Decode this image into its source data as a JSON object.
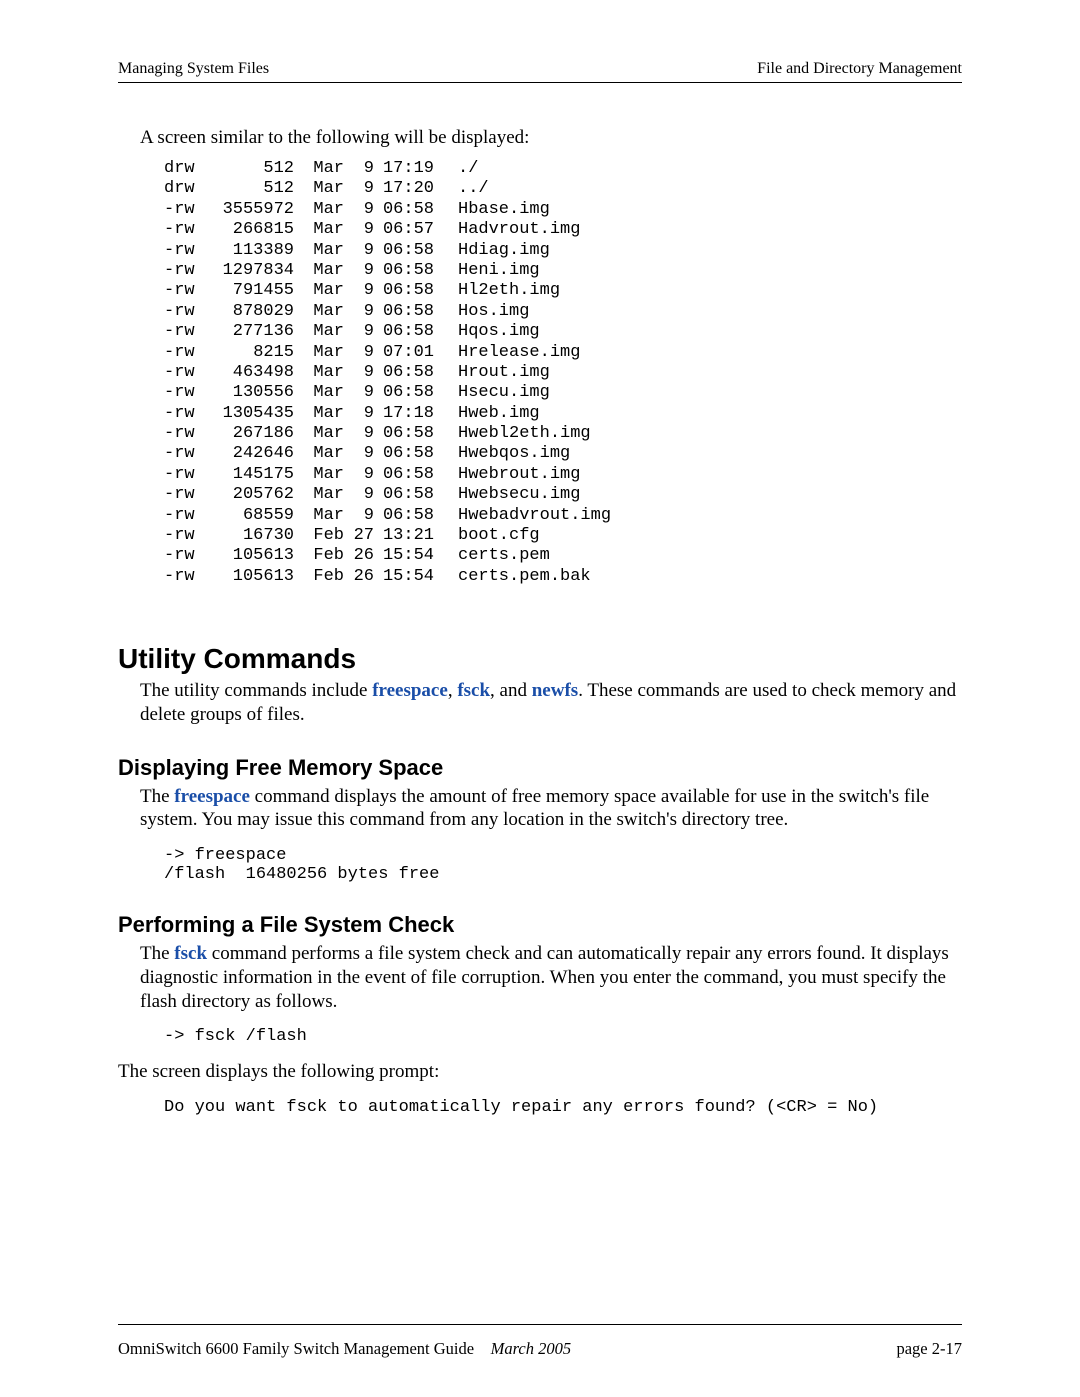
{
  "header": {
    "left": "Managing System Files",
    "right": "File and Directory Management"
  },
  "intro": "A screen similar to the following will be displayed:",
  "listing": [
    {
      "perm": "drw",
      "size": "512",
      "mon": "Mar",
      "day": "9",
      "time": "17:19",
      "name": "./"
    },
    {
      "perm": "drw",
      "size": "512",
      "mon": "Mar",
      "day": "9",
      "time": "17:20",
      "name": "../"
    },
    {
      "perm": "-rw",
      "size": "3555972",
      "mon": "Mar",
      "day": "9",
      "time": "06:58",
      "name": "Hbase.img"
    },
    {
      "perm": "-rw",
      "size": "266815",
      "mon": "Mar",
      "day": "9",
      "time": "06:57",
      "name": "Hadvrout.img"
    },
    {
      "perm": "-rw",
      "size": "113389",
      "mon": "Mar",
      "day": "9",
      "time": "06:58",
      "name": "Hdiag.img"
    },
    {
      "perm": "-rw",
      "size": "1297834",
      "mon": "Mar",
      "day": "9",
      "time": "06:58",
      "name": "Heni.img"
    },
    {
      "perm": "-rw",
      "size": "791455",
      "mon": "Mar",
      "day": "9",
      "time": "06:58",
      "name": "Hl2eth.img"
    },
    {
      "perm": "-rw",
      "size": "878029",
      "mon": "Mar",
      "day": "9",
      "time": "06:58",
      "name": "Hos.img"
    },
    {
      "perm": "-rw",
      "size": "277136",
      "mon": "Mar",
      "day": "9",
      "time": "06:58",
      "name": "Hqos.img"
    },
    {
      "perm": "-rw",
      "size": "8215",
      "mon": "Mar",
      "day": "9",
      "time": "07:01",
      "name": "Hrelease.img"
    },
    {
      "perm": "-rw",
      "size": "463498",
      "mon": "Mar",
      "day": "9",
      "time": "06:58",
      "name": "Hrout.img"
    },
    {
      "perm": "-rw",
      "size": "130556",
      "mon": "Mar",
      "day": "9",
      "time": "06:58",
      "name": "Hsecu.img"
    },
    {
      "perm": "-rw",
      "size": "1305435",
      "mon": "Mar",
      "day": "9",
      "time": "17:18",
      "name": "Hweb.img"
    },
    {
      "perm": "-rw",
      "size": "267186",
      "mon": "Mar",
      "day": "9",
      "time": "06:58",
      "name": "Hwebl2eth.img"
    },
    {
      "perm": "-rw",
      "size": "242646",
      "mon": "Mar",
      "day": "9",
      "time": "06:58",
      "name": "Hwebqos.img"
    },
    {
      "perm": "-rw",
      "size": "145175",
      "mon": "Mar",
      "day": "9",
      "time": "06:58",
      "name": "Hwebrout.img"
    },
    {
      "perm": "-rw",
      "size": "205762",
      "mon": "Mar",
      "day": "9",
      "time": "06:58",
      "name": "Hwebsecu.img"
    },
    {
      "perm": "-rw",
      "size": "68559",
      "mon": "Mar",
      "day": "9",
      "time": "06:58",
      "name": "Hwebadvrout.img"
    },
    {
      "perm": "-rw",
      "size": "16730",
      "mon": "Feb",
      "day": "27",
      "time": "13:21",
      "name": "boot.cfg"
    },
    {
      "perm": "-rw",
      "size": "105613",
      "mon": "Feb",
      "day": "26",
      "time": "15:54",
      "name": "certs.pem"
    },
    {
      "perm": "-rw",
      "size": "105613",
      "mon": "Feb",
      "day": "26",
      "time": "15:54",
      "name": "certs.pem.bak"
    }
  ],
  "h1": "Utility Commands",
  "util_p": {
    "pre": "The utility commands include ",
    "cmd1": "freespace",
    "sep1": ", ",
    "cmd2": "fsck",
    "sep2": ", and ",
    "cmd3": "newfs",
    "post": ". These commands are used to check memory and delete groups of files."
  },
  "h2a": "Displaying Free Memory Space",
  "free_p": {
    "pre": "The ",
    "cmd": "freespace",
    "post": " command displays the amount of free memory space available for use in the switch's file system. You may issue this command from any location in the switch's directory tree."
  },
  "free_code": "-> freespace\n/flash  16480256 bytes free",
  "h2b": "Performing a File System Check",
  "fsck_p": {
    "pre": "The ",
    "cmd": "fsck",
    "post": " command performs a file system check and can automatically repair any errors found. It displays diagnostic information in the event of file corruption. When you enter the command, you must specify the flash directory as follows."
  },
  "fsck_code": "-> fsck /flash",
  "fsck_after": "The screen displays the following prompt:",
  "fsck_prompt": "Do you want fsck to automatically repair any errors found? (<CR> = No)",
  "footer": {
    "left_a": "OmniSwitch 6600 Family Switch Management Guide",
    "left_b": "March 2005",
    "right": "page 2-17"
  }
}
